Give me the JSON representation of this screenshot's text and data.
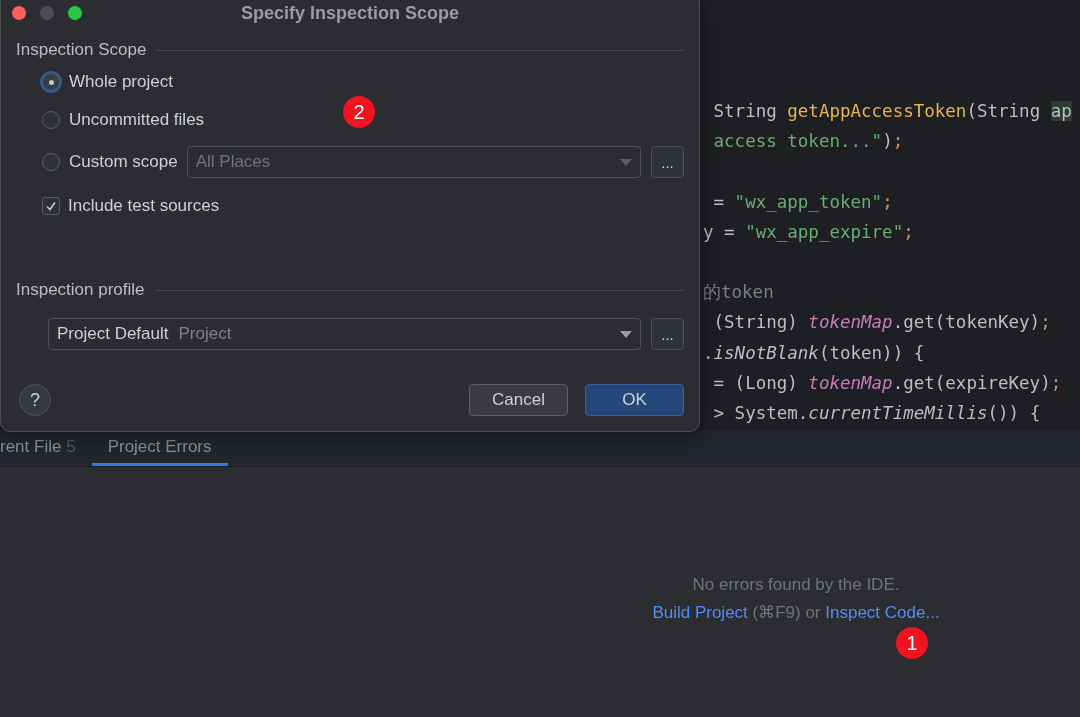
{
  "editor": {
    "blocks": [
      [
        [
          {
            "kind": "plain",
            "text": " String "
          },
          {
            "kind": "method",
            "text": "getAppAccessToken"
          },
          {
            "kind": "plain",
            "text": "(String "
          },
          {
            "kind": "param",
            "text": "ap"
          }
        ],
        [
          {
            "kind": "string",
            "text": " access token...\""
          },
          {
            "kind": "plain",
            "text": ")"
          },
          {
            "kind": "keyword",
            "text": ";"
          }
        ]
      ],
      [
        [
          {
            "kind": "plain",
            "text": " = "
          },
          {
            "kind": "string",
            "text": "\"wx_app_token\""
          },
          {
            "kind": "keyword",
            "text": ";"
          }
        ],
        [
          {
            "kind": "plain",
            "text": "y = "
          },
          {
            "kind": "string",
            "text": "\"wx_app_expire\""
          },
          {
            "kind": "keyword",
            "text": ";"
          }
        ]
      ],
      [
        [
          {
            "kind": "comment",
            "text": "的token"
          }
        ],
        [
          {
            "kind": "plain",
            "text": " (String) "
          },
          {
            "kind": "field",
            "text": "tokenMap"
          },
          {
            "kind": "plain",
            "text": ".get(tokenKey)"
          },
          {
            "kind": "keyword",
            "text": ";"
          }
        ],
        [
          {
            "kind": "plain",
            "text": "."
          },
          {
            "kind": "static",
            "text": "isNotBlank"
          },
          {
            "kind": "plain",
            "text": "(token)) {"
          }
        ],
        [
          {
            "kind": "plain",
            "text": " = (Long) "
          },
          {
            "kind": "field",
            "text": "tokenMap"
          },
          {
            "kind": "plain",
            "text": ".get(expireKey)"
          },
          {
            "kind": "keyword",
            "text": ";"
          }
        ],
        [
          {
            "kind": "plain",
            "text": " > System."
          },
          {
            "kind": "static",
            "text": "currentTimeMillis"
          },
          {
            "kind": "plain",
            "text": "()) {"
          }
        ]
      ]
    ]
  },
  "tool_window": {
    "tabs": [
      {
        "label": "rent File",
        "count": "5",
        "selected": false
      },
      {
        "label": "Project Errors",
        "selected": true
      }
    ],
    "empty_state": {
      "message": "No errors found by the IDE.",
      "actions": [
        {
          "kind": "link",
          "text": "Build Project"
        },
        {
          "kind": "text",
          "text": " (⌘F9) or "
        },
        {
          "kind": "link",
          "text": "Inspect Code..."
        }
      ]
    }
  },
  "dialog": {
    "title": "Specify Inspection Scope",
    "scope_section": {
      "title": "Inspection Scope",
      "options": [
        {
          "label": "Whole project",
          "selected": true
        },
        {
          "label": "Uncommitted files",
          "selected": false
        },
        {
          "label": "Custom scope",
          "selected": false
        }
      ],
      "custom_scope": {
        "value": "All Places",
        "disabled": true,
        "more": "..."
      },
      "include_test_sources": {
        "label": "Include test sources",
        "checked": true
      }
    },
    "profile_section": {
      "title": "Inspection profile",
      "profile": {
        "value": "Project Default",
        "hint": "Project",
        "more": "..."
      }
    },
    "help": "?",
    "buttons": [
      {
        "label": "Cancel",
        "kind": "default"
      },
      {
        "label": "OK",
        "kind": "primary"
      }
    ]
  },
  "badges": [
    {
      "text": "2"
    },
    {
      "text": "1"
    }
  ]
}
